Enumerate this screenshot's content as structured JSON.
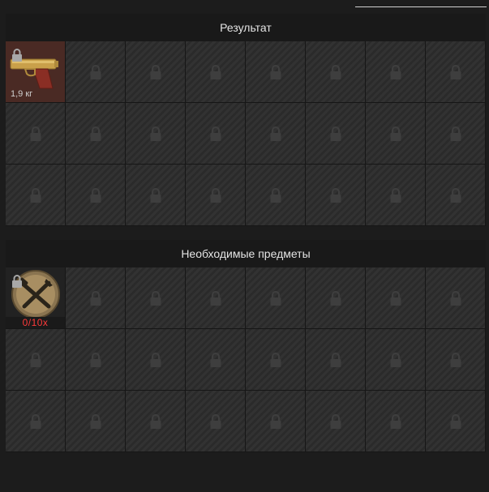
{
  "result": {
    "title": "Результат",
    "item": {
      "icon": "desert-eagle-gold-icon",
      "weight": "1,9 кг"
    }
  },
  "required": {
    "title": "Необходимые предметы",
    "item": {
      "icon": "crossed-tools-icon",
      "count": "0/10x"
    }
  },
  "colors": {
    "accent_red": "#ff3a3a",
    "cell": "#2d2d2d",
    "header": "#191919"
  }
}
